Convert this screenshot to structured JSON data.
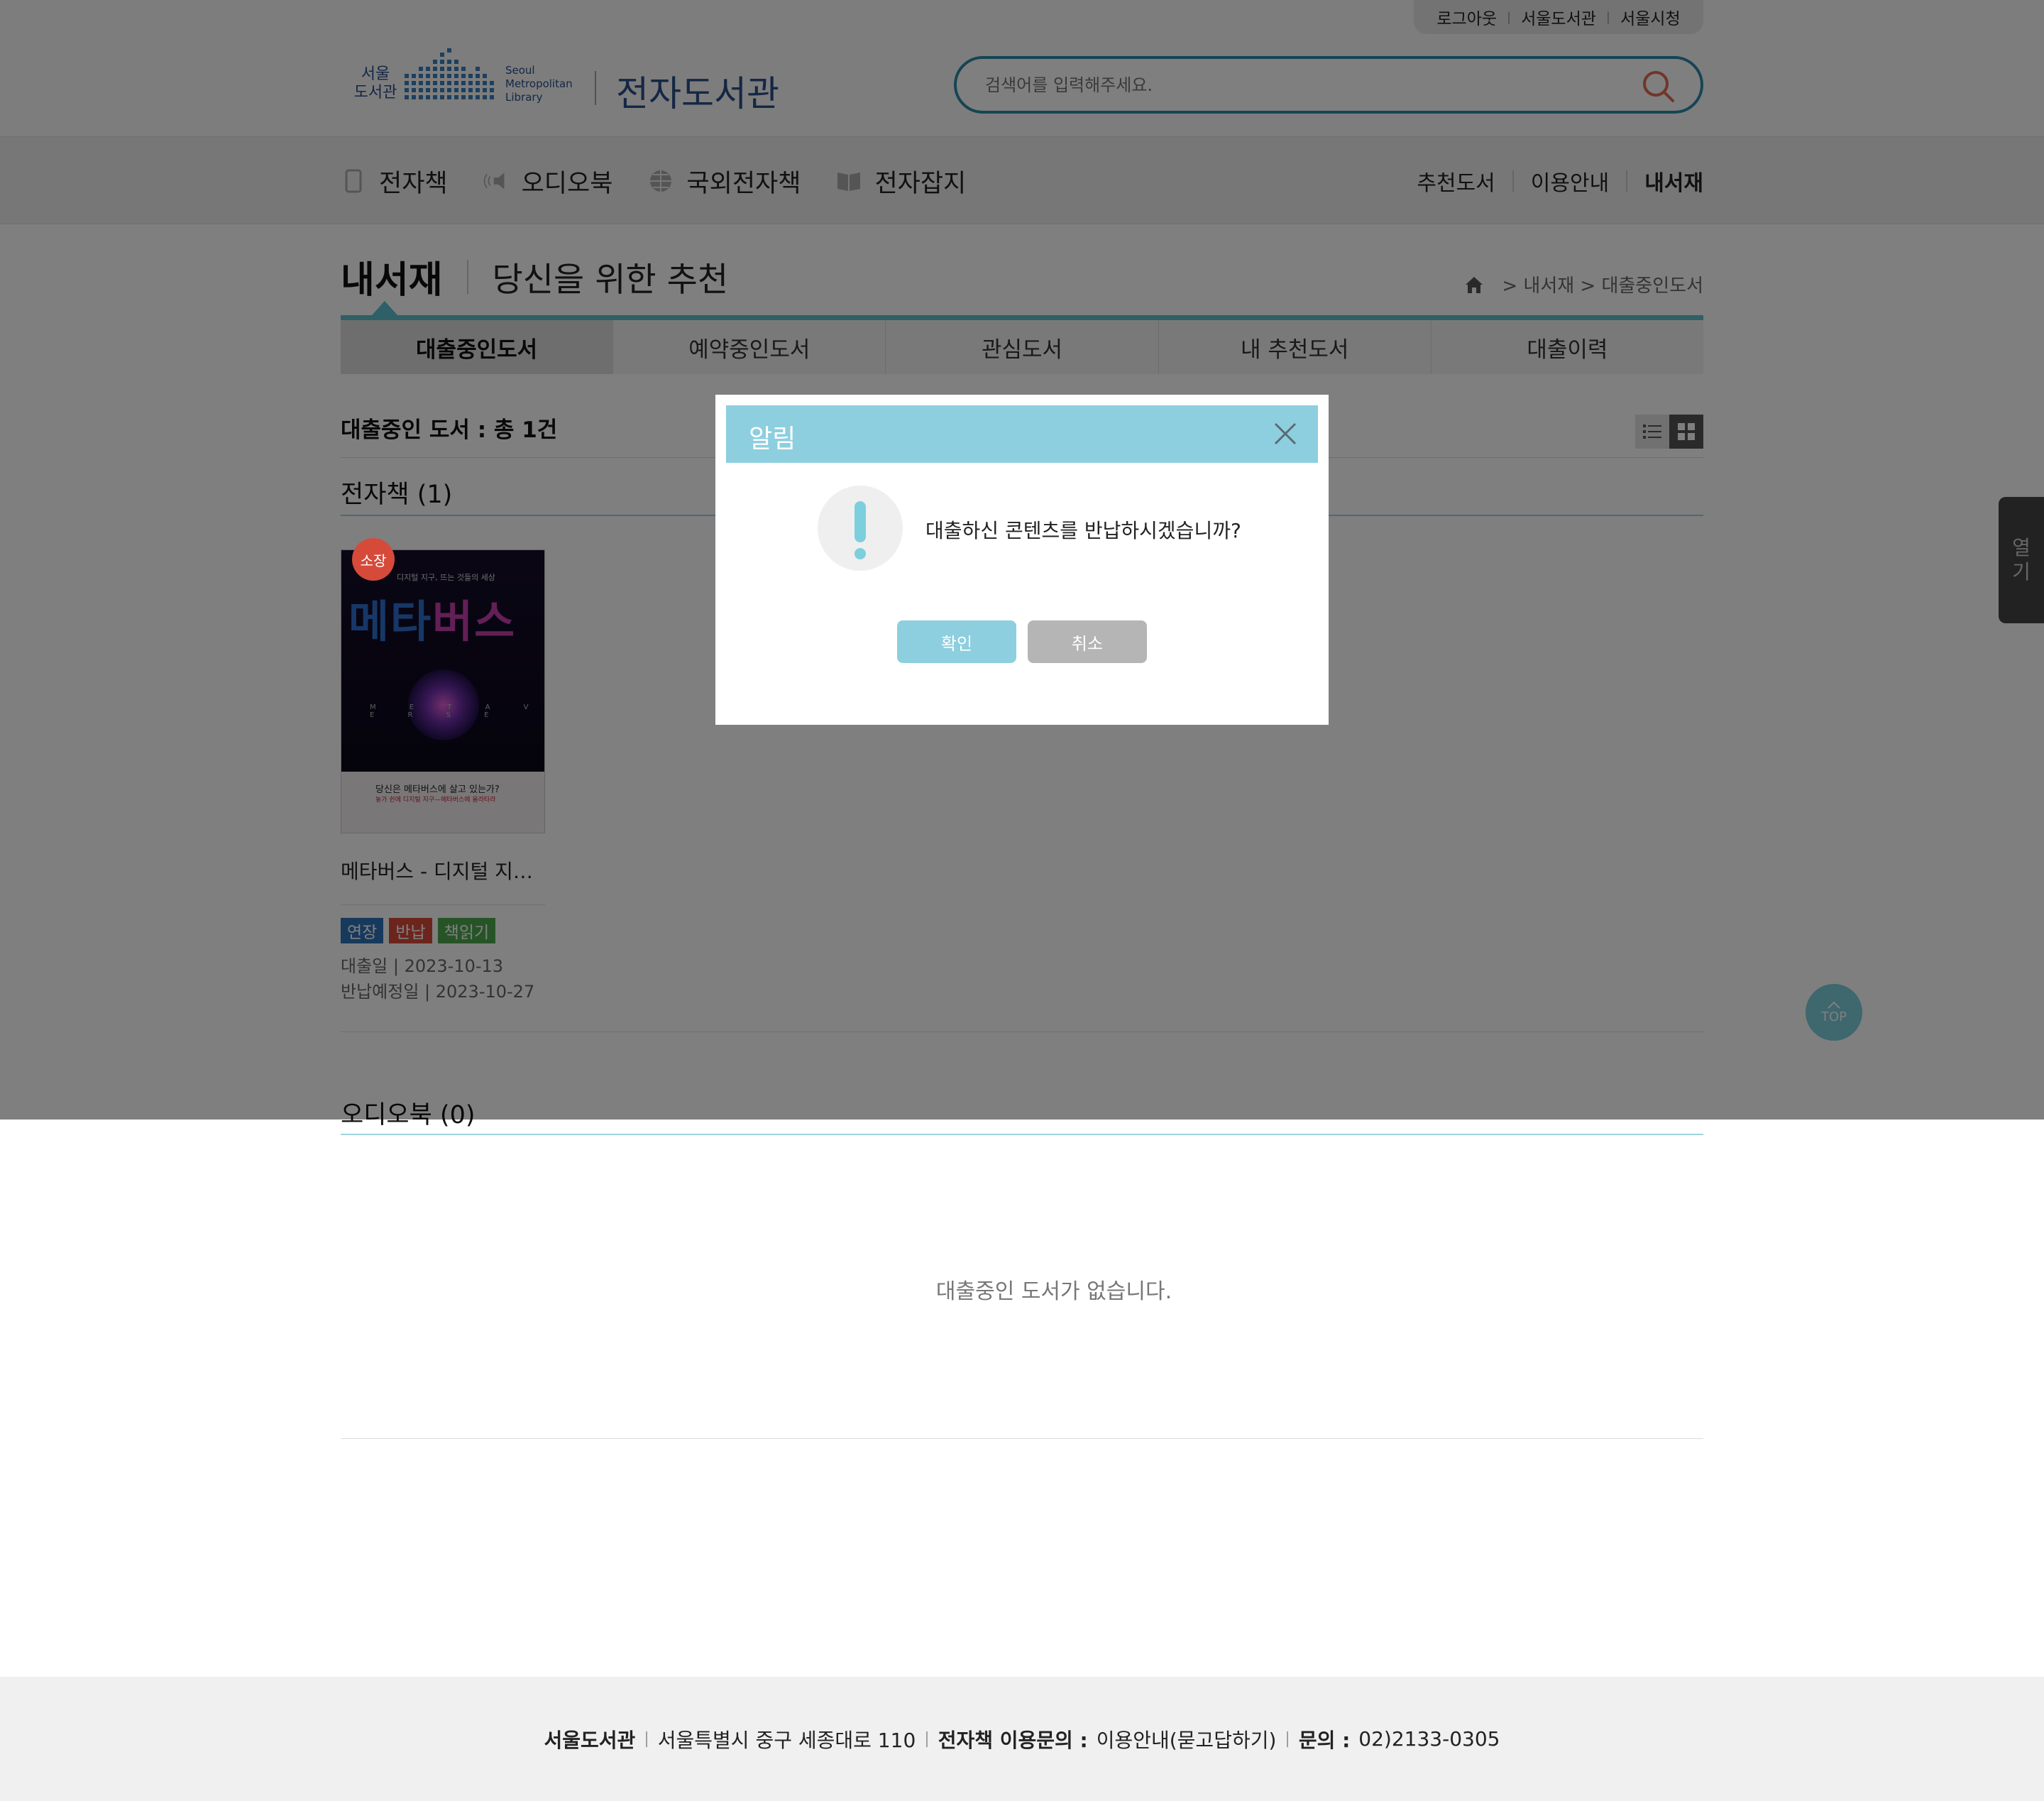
{
  "util": {
    "logout": "로그아웃",
    "seoul_library": "서울도서관",
    "seoul_city": "서울시청"
  },
  "logo": {
    "kr_line1": "서울",
    "kr_line2": "도서관",
    "en_line1": "Seoul",
    "en_line2": "Metropolitan",
    "en_line3": "Library",
    "site_title": "전자도서관"
  },
  "search": {
    "placeholder": "검색어를 입력해주세요."
  },
  "gnb": {
    "items": [
      {
        "label": "전자책",
        "icon": "tablet-icon"
      },
      {
        "label": "오디오북",
        "icon": "speaker-icon"
      },
      {
        "label": "국외전자책",
        "icon": "globe-icon"
      },
      {
        "label": "전자잡지",
        "icon": "magazine-icon"
      }
    ],
    "right": [
      "추천도서",
      "이용안내",
      "내서재"
    ]
  },
  "page": {
    "title": "내서재",
    "subtitle": "당신을 위한 추천"
  },
  "breadcrumb": {
    "path": "> 내서재 > 대출중인도서"
  },
  "tabs": [
    "대출중인도서",
    "예약중인도서",
    "관심도서",
    "내 추천도서",
    "대출이력"
  ],
  "summary": {
    "count_title": "대출중인 도서 : 총 1건"
  },
  "ebook_section": {
    "title": "전자책 (1)"
  },
  "book": {
    "badge": "소장",
    "cover_subtitle": "디지털 지구, 뜨는 것들의 세상",
    "cover_title_a": "메타",
    "cover_title_b": "버스",
    "cover_meta": "M E T A V E R S E",
    "cover_line1": "당신은 메타버스에 살고 있는가?",
    "cover_line2": "놓가 쉰에 디지털 지구—메타버스에 올라타라",
    "name": "메타버스 - 디지털 지구,…",
    "btn_extend": "연장",
    "btn_return": "반납",
    "btn_read": "책읽기",
    "loan_date": "대출일 | 2023-10-13",
    "due_date": "반납예정일 | 2023-10-27"
  },
  "audio_section": {
    "title": "오디오북 (0)",
    "empty": "대출중인 도서가 없습니다."
  },
  "footer": {
    "org": "서울도서관",
    "address": "서울특별시 중구 세종대로 110",
    "inquiry_label": "전자책 이용문의 :",
    "inquiry_value": "이용안내(묻고답하기)",
    "phone_label": "문의 :",
    "phone_value": "02)2133-0305"
  },
  "side_tab": {
    "line1": "열",
    "line2": "기"
  },
  "top_button": {
    "label": "TOP"
  },
  "modal": {
    "title": "알림",
    "message": "대출하신 콘텐츠를 반납하시겠습니까?",
    "confirm": "확인",
    "cancel": "취소"
  },
  "colors": {
    "accent": "#5fbfcf",
    "modal_header": "#8dcfdf",
    "brand_blue": "#2a4e8a",
    "search_border": "#2a8aa8"
  }
}
